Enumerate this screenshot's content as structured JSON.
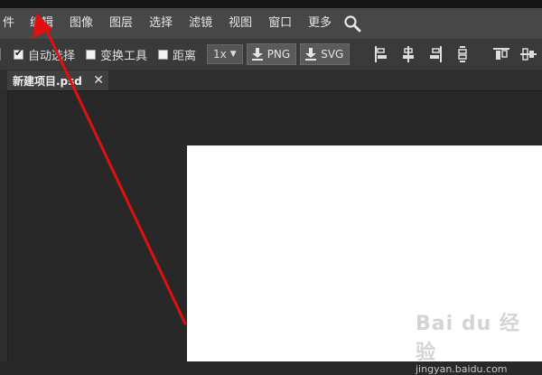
{
  "menubar": {
    "items": [
      "件",
      "编辑",
      "图像",
      "图层",
      "选择",
      "滤镜",
      "视图",
      "窗口",
      "更多"
    ],
    "search_icon": "search-icon"
  },
  "toolbar": {
    "auto_select_label": "自动选择",
    "auto_select_checked": true,
    "transform_label": "变换工具",
    "transform_checked": false,
    "distance_label": "距离",
    "distance_checked": false,
    "scale_value": "1x",
    "export_png_label": "PNG",
    "export_svg_label": "SVG",
    "align_icons": [
      "align-left-icon",
      "align-center-h-icon",
      "align-right-icon",
      "align-distribute-icon",
      "align-top-icon",
      "align-middle-v-icon"
    ]
  },
  "tabs": [
    {
      "label": "新建项目.psd",
      "close": "✕"
    }
  ],
  "watermark": {
    "line1": "Bai du 经验",
    "line2": "jingyan.baidu.com"
  },
  "colors": {
    "menubar_bg": "#474747",
    "toolbar_bg": "#3a3a3a",
    "canvas_bg": "#282828",
    "document_bg": "#ffffff",
    "annotation_arrow": "#e01010"
  }
}
